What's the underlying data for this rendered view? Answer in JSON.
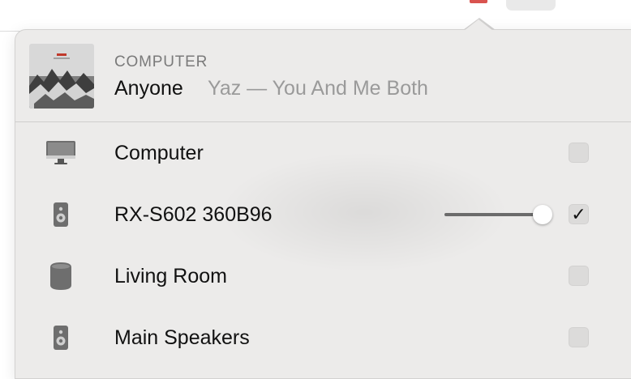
{
  "now_playing": {
    "source": "COMPUTER",
    "title": "Anyone",
    "subtitle": "Yaz — You And Me Both"
  },
  "devices": [
    {
      "label": "Computer",
      "icon": "imac-icon",
      "checked": false
    },
    {
      "label": "RX-S602 360B96",
      "icon": "speaker-icon",
      "checked": true,
      "volume": 0.93
    },
    {
      "label": "Living Room",
      "icon": "homepod-icon",
      "checked": false
    },
    {
      "label": "Main Speakers",
      "icon": "speaker-icon",
      "checked": false
    }
  ],
  "check_glyph": "✓"
}
